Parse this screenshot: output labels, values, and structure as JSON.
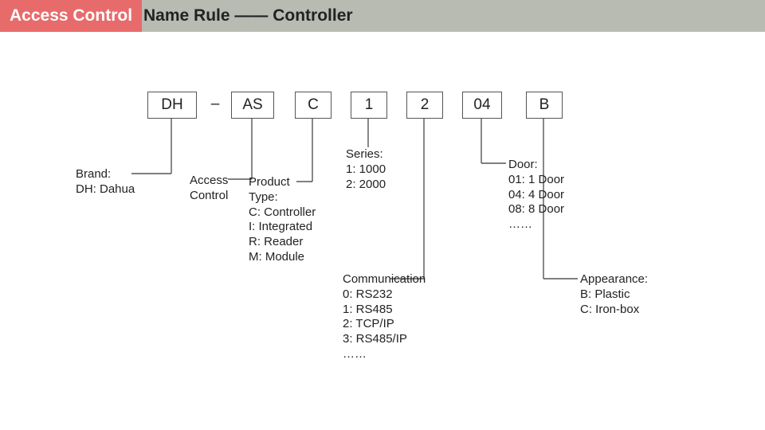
{
  "header": {
    "badge": "Access Control",
    "rest": "Name Rule —— Controller"
  },
  "code": {
    "dh": "DH",
    "dash": "–",
    "as": "AS",
    "c": "C",
    "one": "1",
    "two": "2",
    "o4": "04",
    "b": "B"
  },
  "labels": {
    "brand": "Brand:\nDH: Dahua",
    "access": "Access\nControl",
    "product": "Product\nType:\nC: Controller\nI: Integrated\nR: Reader\nM: Module",
    "series": "Series:\n1: 1000\n2: 2000",
    "comm": "Communication\n0: RS232\n1: RS485\n2: TCP/IP\n3: RS485/IP\n……",
    "door": "Door:\n01: 1 Door\n04: 4 Door\n08: 8 Door\n……",
    "appear": "Appearance:\nB: Plastic\nC: Iron-box"
  }
}
